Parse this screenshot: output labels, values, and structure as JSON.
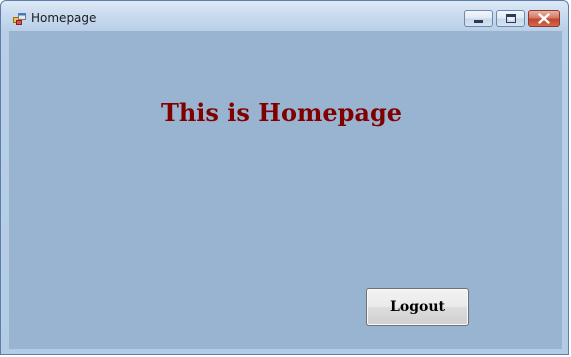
{
  "window": {
    "title": "Homepage",
    "icon": "app-window-icon"
  },
  "caption_buttons": {
    "minimize_icon": "minimize-icon",
    "maximize_icon": "restore-icon",
    "close_icon": "close-icon"
  },
  "main": {
    "heading": "This is Homepage",
    "logout_label": "Logout"
  },
  "colors": {
    "client_background": "#99b4d1",
    "heading": "#800000",
    "close_button": "#c0452d"
  }
}
